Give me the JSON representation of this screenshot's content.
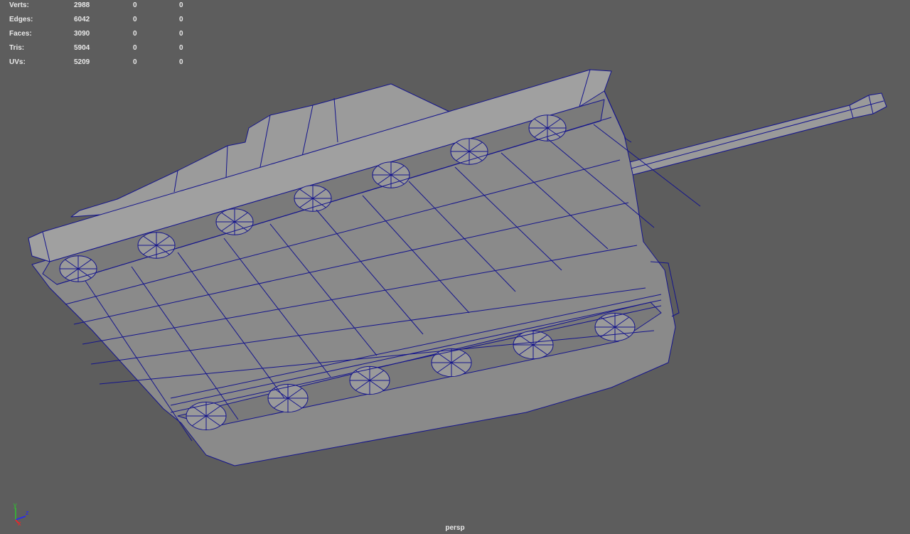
{
  "hud": {
    "rows": [
      {
        "label": "Verts:",
        "a": "2988",
        "b": "0",
        "c": "0"
      },
      {
        "label": "Edges:",
        "a": "6042",
        "b": "0",
        "c": "0"
      },
      {
        "label": "Faces:",
        "a": "3090",
        "b": "0",
        "c": "0"
      },
      {
        "label": "Tris:",
        "a": "5904",
        "b": "0",
        "c": "0"
      },
      {
        "label": "UVs:",
        "a": "5209",
        "b": "0",
        "c": "0"
      }
    ]
  },
  "camera": "persp",
  "axis": {
    "x": "x",
    "y": "y",
    "z": "z"
  },
  "colors": {
    "background": "#5d5d5d",
    "wire": "#14148c",
    "light_face": "#9c9c9c",
    "mid_face": "#8a8a8a",
    "dark_face": "#7a7a7a"
  }
}
